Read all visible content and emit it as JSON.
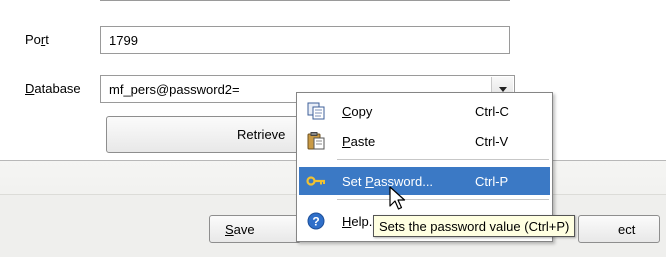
{
  "form": {
    "port": {
      "label_pre": "Po",
      "label_mnemonic": "r",
      "label_post": "t",
      "value": "1799"
    },
    "database": {
      "label_mnemonic": "D",
      "label_post": "atabase",
      "value": "mf_pers@password2="
    },
    "retrieve_label": "Retrieve"
  },
  "footer": {
    "save_mnemonic": "S",
    "save_post": "ave",
    "right_button_visible": "ect"
  },
  "context_menu": {
    "copy": {
      "mnemonic": "C",
      "post": "opy",
      "shortcut": "Ctrl-C"
    },
    "paste": {
      "mnemonic": "P",
      "post": "aste",
      "shortcut": "Ctrl-V"
    },
    "set_password": {
      "pre": "Set ",
      "mnemonic": "P",
      "post": "assword...",
      "shortcut": "Ctrl-P"
    },
    "help": {
      "mnemonic": "H",
      "post": "elp."
    }
  },
  "tooltip": {
    "text": "Sets the password value (Ctrl+P)"
  },
  "colors": {
    "selection": "#3b79c5",
    "tooltip_bg": "#ffffe1"
  }
}
